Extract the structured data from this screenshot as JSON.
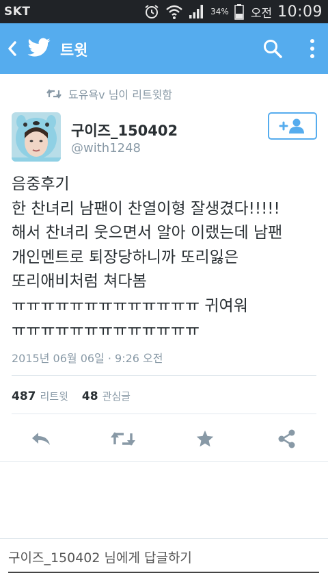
{
  "status_bar": {
    "carrier": "SKT",
    "battery_percent": "34%",
    "ampm": "오전",
    "time": "10:09",
    "icons": [
      "alarm-icon",
      "wifi-icon",
      "signal-icon",
      "battery-icon"
    ]
  },
  "app_bar": {
    "title": "트윗",
    "color": "#55acee",
    "icons": [
      "back-icon",
      "twitter-bird-icon",
      "search-icon",
      "more-vert-icon"
    ]
  },
  "retweet_context": {
    "text": "됴유욕v 님이 리트윗함",
    "icon": "retweet-icon"
  },
  "tweet": {
    "author_name": "구이즈_150402",
    "author_handle": "@with1248",
    "follow_icon": "add-user-icon",
    "text": "음중후기\n한 찬녀리 남팬이 찬열이형 잘생겼다!!!!!\n해서 찬녀리 웃으면서 알아 이랬는데 남팬\n개인멘트로 퇴장당하니까 또리잃은\n또리애비처럼 쳐다봄\nㅠㅠㅠㅠㅠㅠㅠㅠㅠㅠㅠㅠㅠ 귀여워\nㅠㅠㅠㅠㅠㅠㅠㅠㅠㅠㅠㅠㅠ",
    "timestamp": "2015년 06월 06일 · 9:26 오전"
  },
  "stats": {
    "retweets_count": "487",
    "retweets_label": "리트윗",
    "likes_count": "48",
    "likes_label": "관심글"
  },
  "actions": [
    "reply-icon",
    "retweet-icon",
    "favorite-star-icon",
    "share-icon"
  ],
  "reply_bar": {
    "placeholder": "구이즈_150402 님에게 답글하기"
  }
}
